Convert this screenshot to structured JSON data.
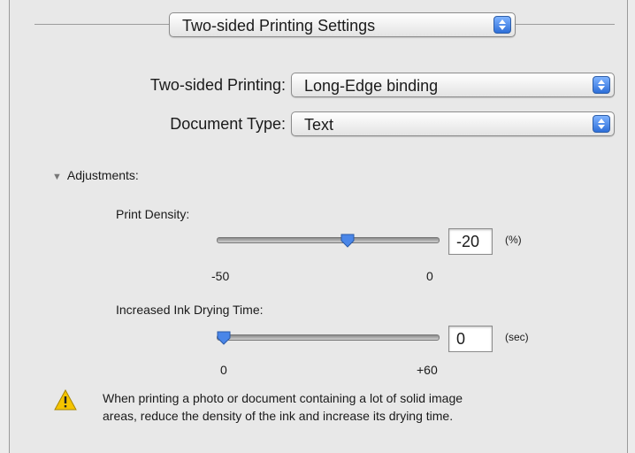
{
  "mode_popup": {
    "label": "Two-sided Printing Settings"
  },
  "two_sided_printing": {
    "label": "Two-sided Printing:",
    "value": "Long-Edge binding"
  },
  "document_type": {
    "label": "Document Type:",
    "value": "Text"
  },
  "adjustments": {
    "label": "Adjustments:",
    "disclosure_symbol": "▼"
  },
  "print_density": {
    "label": "Print Density:",
    "value": "-20",
    "unit": "(%)",
    "min_label": "-50",
    "zero_label": "0",
    "slider_level": 0.6
  },
  "ink_drying_time": {
    "label": "Increased Ink Drying Time:",
    "value": "0",
    "unit": "(sec)",
    "min_label": "0",
    "max_label": "+60",
    "slider_level": 0.0
  },
  "warning": {
    "icon": "warning-triangle-icon",
    "line1": "When printing a photo or document containing a lot of solid image",
    "line2": "areas, reduce the density of the ink and increase its drying time."
  },
  "colors": {
    "accent": "#2e6fd9",
    "panel": "#e8e8e8"
  }
}
